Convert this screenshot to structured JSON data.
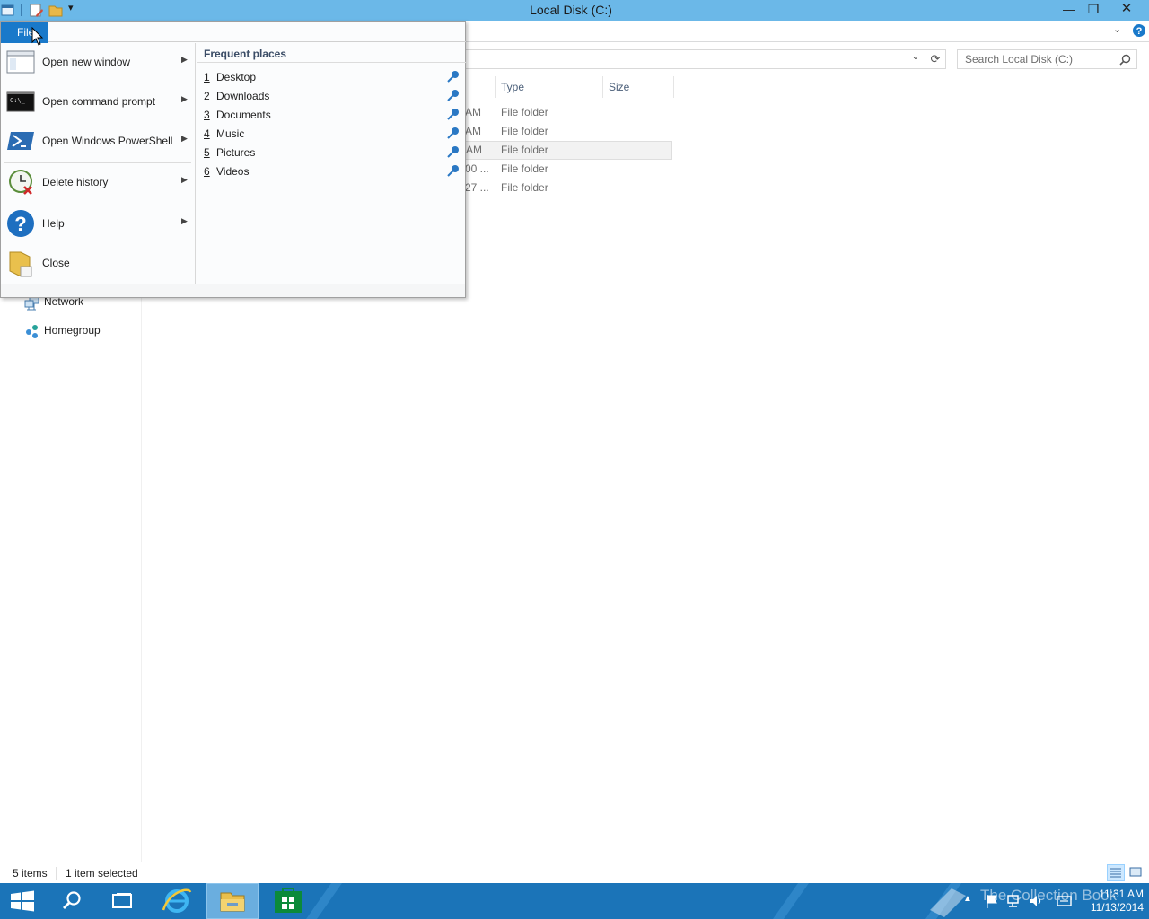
{
  "window": {
    "title": "Local Disk (C:)",
    "minimize_glyph": "—",
    "maximize_glyph": "❐",
    "close_glyph": "✕"
  },
  "ribbon": {
    "file_tab_label": "File"
  },
  "address_bar": {
    "search_placeholder": "Search Local Disk (C:)"
  },
  "nav_pane": {
    "items": [
      {
        "label": "Network",
        "icon": "network-icon"
      },
      {
        "label": "Homegroup",
        "icon": "homegroup-icon"
      }
    ]
  },
  "file_list": {
    "columns": [
      "Type",
      "Size"
    ],
    "rows": [
      {
        "date_fragment": "AM",
        "type": "File folder",
        "selected": false
      },
      {
        "date_fragment": "AM",
        "type": "File folder",
        "selected": false
      },
      {
        "date_fragment": "AM",
        "type": "File folder",
        "selected": true
      },
      {
        "date_fragment": "00 ...",
        "type": "File folder",
        "selected": false
      },
      {
        "date_fragment": "27 ...",
        "type": "File folder",
        "selected": false
      }
    ]
  },
  "status_bar": {
    "item_count": "5 items",
    "selection": "1 item selected"
  },
  "file_menu": {
    "tab_label": "File",
    "items": [
      {
        "label": "Open new window",
        "icon": "new-window-icon",
        "has_submenu": true
      },
      {
        "label": "Open command prompt",
        "icon": "command-prompt-icon",
        "has_submenu": true
      },
      {
        "label": "Open Windows PowerShell",
        "icon": "powershell-icon",
        "has_submenu": true
      },
      {
        "label": "Delete history",
        "icon": "delete-history-icon",
        "has_submenu": true
      },
      {
        "label": "Help",
        "icon": "help-icon",
        "has_submenu": true
      },
      {
        "label": "Close",
        "icon": "close-folder-icon",
        "has_submenu": false
      }
    ],
    "frequent_places_header": "Frequent places",
    "frequent_places": [
      {
        "num": "1",
        "name": "Desktop"
      },
      {
        "num": "2",
        "name": "Downloads"
      },
      {
        "num": "3",
        "name": "Documents"
      },
      {
        "num": "4",
        "name": "Music"
      },
      {
        "num": "5",
        "name": "Pictures"
      },
      {
        "num": "6",
        "name": "Videos"
      }
    ]
  },
  "taskbar": {
    "pinned": [
      "start-icon",
      "search-icon",
      "task-view-icon",
      "internet-explorer-icon",
      "file-explorer-icon",
      "store-icon"
    ],
    "watermark": "The Collection Book",
    "time": "11:31 AM",
    "date": "11/13/2014"
  },
  "colors": {
    "titlebar": "#6bb8e8",
    "file_tab": "#1979ca",
    "taskbar": "#1b74b8",
    "selection": "#cde8ff"
  }
}
